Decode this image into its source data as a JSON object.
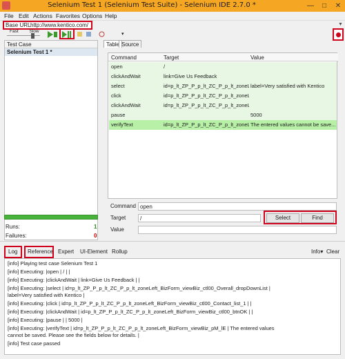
{
  "window": {
    "title": "Selenium Test 1 (Selenium Test Suite) - Selenium IDE 2.7.0 *",
    "controls": [
      "—",
      "□",
      "✕"
    ]
  },
  "menu": [
    "File",
    "Edit",
    "Actions",
    "Favorites",
    "Options",
    "Help"
  ],
  "base_url": {
    "label": "Base URL",
    "value": "http://www.kentico.com/"
  },
  "speed": {
    "fast": "Fast",
    "slow": "Slow"
  },
  "left_panel": {
    "header": "Test Case",
    "test_case": "Selenium Test 1 *",
    "runs_label": "Runs:",
    "runs_value": "1",
    "failures_label": "Failures:",
    "failures_value": "0"
  },
  "editor_tabs": [
    "Table",
    "Source"
  ],
  "table": {
    "headers": [
      "Command",
      "Target",
      "Value"
    ],
    "rows": [
      {
        "command": "open",
        "target": "/",
        "value": ""
      },
      {
        "command": "clickAndWait",
        "target": "link=Give Us Feedback",
        "value": ""
      },
      {
        "command": "select",
        "target": "id=p_lt_ZP_P_p_lt_ZC_P_p_lt_zoneL...",
        "value": "label=Very satisfied with Kentico"
      },
      {
        "command": "click",
        "target": "id=p_lt_ZP_P_p_lt_ZC_P_p_lt_zoneL...",
        "value": ""
      },
      {
        "command": "clickAndWait",
        "target": "id=p_lt_ZP_P_p_lt_ZC_P_p_lt_zoneL...",
        "value": ""
      },
      {
        "command": "pause",
        "target": "",
        "value": "5000"
      },
      {
        "command": "verifyText",
        "target": "id=p_lt_ZP_P_p_lt_ZC_P_p_lt_zoneL...",
        "value": "The entered values cannot be save..."
      }
    ]
  },
  "command_editor": {
    "command_label": "Command",
    "command_value": "open",
    "target_label": "Target",
    "target_value": "/",
    "value_label": "Value",
    "value_value": "",
    "select_button": "Select",
    "find_button": "Find"
  },
  "log_tabs": [
    "Log",
    "Reference",
    "Expert",
    "UI-Element",
    "Rollup"
  ],
  "log_actions": {
    "info": "Info▾",
    "clear": "Clear"
  },
  "log_lines": [
    "[info] Playing test case Selenium Test 1",
    "[info] Executing: |open | / | |",
    "[info] Executing: |clickAndWait | link=Give Us Feedback | |",
    "[info] Executing: |select | id=p_lt_ZP_P_p_lt_ZC_P_p_lt_zoneLeft_BizForm_viewBiz_ctl00_Overall_dropDownList |",
    "label=Very satisfied with Kentico |",
    "[info] Executing: |click | id=p_lt_ZP_P_p_lt_ZC_P_p_lt_zoneLeft_BizForm_viewBiz_ctl00_Contact_list_1 | |",
    "[info] Executing: |clickAndWait | id=p_lt_ZP_P_p_lt_ZC_P_p_lt_zoneLeft_BizForm_viewBiz_ctl00_btnOK | |",
    "[info] Executing: |pause | | 5000 |",
    "[info] Executing: |verifyText | id=p_lt_ZP_P_p_lt_ZC_P_p_lt_zoneLeft_BizForm_viewBiz_pM_lE | The entered values",
    "cannot be saved. Please see the fields below for details. |",
    "[info] Test case passed"
  ],
  "colors": {
    "titlebar": "#f5a623",
    "highlight": "#d0021b",
    "row_bg": "#e8f7e4",
    "row_selected": "#b8f0a8",
    "progress": "#48b33a"
  },
  "icons": {
    "app": "selenium-app-icon",
    "play_all": "play-all-icon",
    "play_current": "play-current-icon",
    "pause": "pause-icon",
    "step": "step-icon",
    "rollup": "rollup-icon",
    "schedule": "schedule-icon",
    "record": "record-icon"
  }
}
